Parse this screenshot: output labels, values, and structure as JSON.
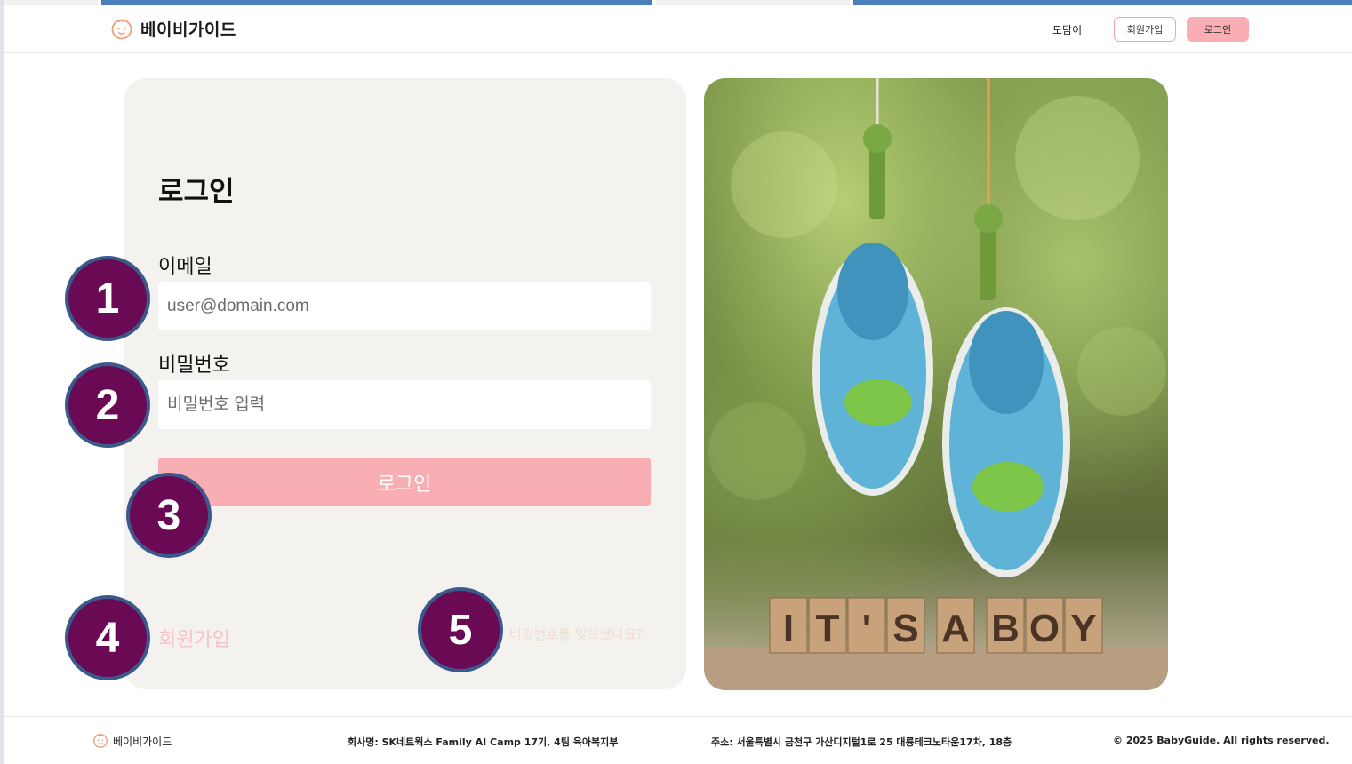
{
  "colors": {
    "brand_pink": "#f9aeb3",
    "card_bg": "#f4f2ee",
    "badge_fill": "#6a0a55",
    "badge_border": "#3b5a8c",
    "top_strip": "#4a7ebb"
  },
  "header": {
    "logo_icon": "baby-face-icon",
    "logo_text": "베이비가이드",
    "nav_help": "도담이",
    "signup_label": "회원가입",
    "login_label": "로그인"
  },
  "form": {
    "title": "로그인",
    "email_label": "이메일",
    "email_placeholder": "user@domain.com",
    "password_label": "비밀번호",
    "password_placeholder": "비밀번호 입력",
    "submit_label": "로그인",
    "signup_link": "회원가입",
    "forgot_link": "비밀번호를 잊으셨나요?"
  },
  "hero_image": {
    "blocks_text": "IT'S A BOY"
  },
  "badges": [
    "1",
    "2",
    "3",
    "4",
    "5"
  ],
  "footer": {
    "logo_icon": "baby-face-icon",
    "logo_text": "베이비가이드",
    "company": "회사명: SK네트웍스 Family AI Camp 17기, 4팀 육아복지부",
    "address": "주소: 서울특별시 금천구 가산디지털1로 25 대륭테크노타운17차, 18층",
    "copyright": "© 2025 BabyGuide. All rights reserved."
  }
}
